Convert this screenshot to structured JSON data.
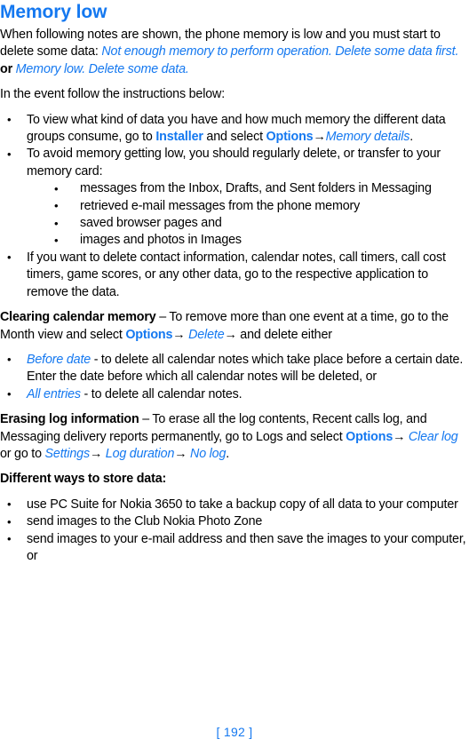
{
  "page": {
    "title": "Memory low",
    "footer": "[ 192 ]"
  },
  "colors": {
    "accent_blue": "#1478f0",
    "text_black": "#000000",
    "background": "#ffffff"
  },
  "intro": {
    "lead_1": "When following notes are shown, the phone memory is low and you must start to delete some data: ",
    "note_1": "Not enough memory to perform operation. Delete some data first.",
    "conjunction": " or ",
    "note_2": "Memory low. Delete some data.",
    "instruction_line": "In the event follow the instructions below:"
  },
  "bullets": {
    "item_1": {
      "text_before": "To view what kind of data you have and how much memory the different data groups consume, go to ",
      "link_installer": "Installer",
      "text_mid": " and select ",
      "link_options": "Options",
      "arrow": "→",
      "link_memory_details": "Memory details",
      "text_after": "."
    },
    "item_2": {
      "text": "To avoid memory getting low, you should regularly delete, or transfer to your memory card:"
    },
    "sub_items": [
      "messages from the Inbox, Drafts, and Sent folders in Messaging",
      "retrieved e-mail messages from the phone memory",
      "saved browser pages and",
      "images and photos in Images"
    ],
    "item_3": {
      "text": "If you want to delete contact information, calendar notes, call timers, call cost timers, game scores, or any other data, go to the respective application to remove the data."
    }
  },
  "calendar_section": {
    "heading": "Clearing calendar memory",
    "dash": " – ",
    "text_before": "To remove more than one event at a time, go to the Month view and select ",
    "link_options": "Options",
    "arrow_1": "→ ",
    "link_delete": "Delete",
    "arrow_2": "→",
    "text_after": " and delete either",
    "bullets": [
      {
        "link": "Before date",
        "text": " - to delete all calendar notes which take place before a certain date. Enter the date before which all calendar notes will be deleted, or"
      },
      {
        "link": "All entries",
        "text": " - to delete all calendar notes."
      }
    ]
  },
  "log_section": {
    "heading": "Erasing log information",
    "dash": " – ",
    "text_before": "To erase all the log contents, Recent calls log, and Messaging delivery reports permanently, go to Logs and select ",
    "link_options": "Options",
    "arrow_1": "→ ",
    "link_clear_log": "Clear log",
    "text_mid_1": " or go to ",
    "link_settings": "Settings",
    "arrow_2": "→ ",
    "link_log_duration": "Log duration",
    "arrow_3": "→ ",
    "link_no_log": "No log",
    "text_after": "."
  },
  "store_section": {
    "heading": "Different ways to store data",
    "colon": ":",
    "bullets": [
      "use PC Suite for Nokia 3650 to take a backup copy of all data to your computer",
      "send images to the Club Nokia Photo Zone",
      "send images to your e-mail address and then save the images to your computer, or"
    ]
  }
}
